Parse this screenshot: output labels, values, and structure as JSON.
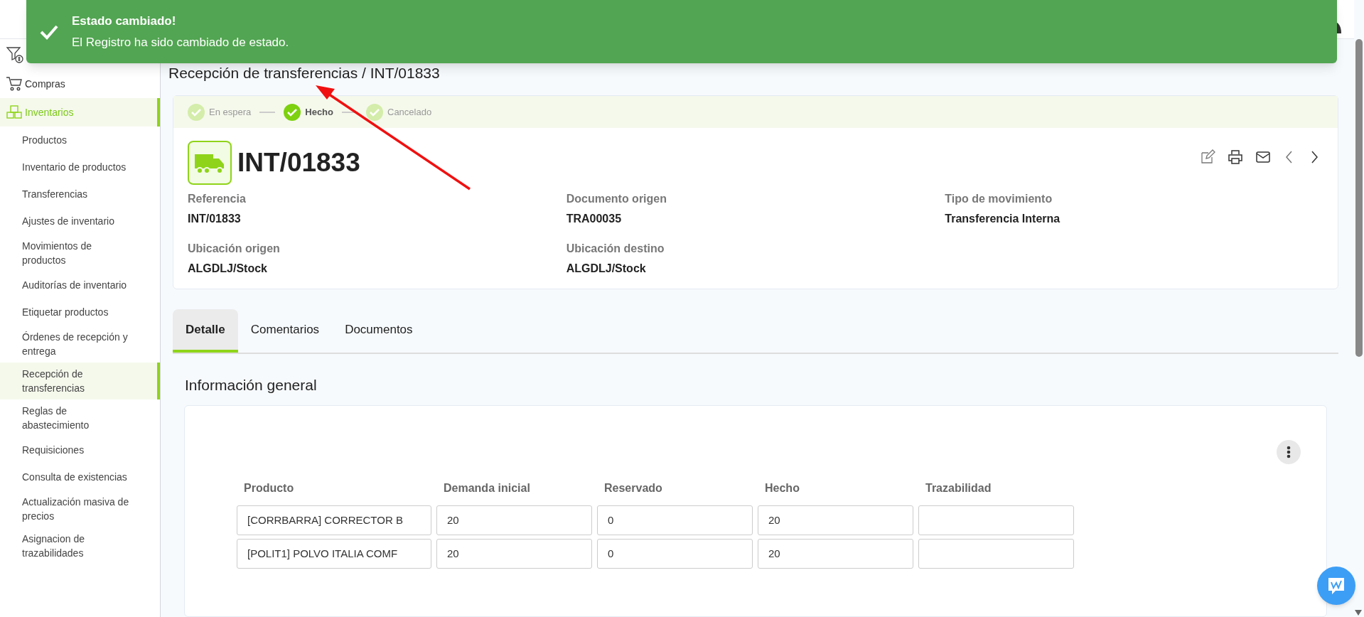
{
  "toast": {
    "title": "Estado cambiado!",
    "message": "El Registro ha sido cambiado de estado."
  },
  "sidebar": {
    "modules": [
      {
        "label": "Compras",
        "selected": false
      },
      {
        "label": "Inventarios",
        "selected": true
      }
    ],
    "items": [
      {
        "label": "Productos",
        "selected": false
      },
      {
        "label": "Inventario de productos",
        "selected": false
      },
      {
        "label": "Transferencias",
        "selected": false
      },
      {
        "label": "Ajustes de inventario",
        "selected": false
      },
      {
        "label": "Movimientos de productos",
        "selected": false
      },
      {
        "label": "Auditorías de inventario",
        "selected": false
      },
      {
        "label": "Etiquetar productos",
        "selected": false
      },
      {
        "label": "Órdenes de recepción y entrega",
        "selected": false
      },
      {
        "label": "Recepción de transferencias",
        "selected": true
      },
      {
        "label": "Reglas de abastecimiento",
        "selected": false
      },
      {
        "label": "Requisiciones",
        "selected": false
      },
      {
        "label": "Consulta de existencias",
        "selected": false
      },
      {
        "label": "Actualización masiva de precios",
        "selected": false
      },
      {
        "label": "Asignacion de trazabilidades",
        "selected": false
      }
    ]
  },
  "page_title": "Recepción de transferencias / INT/01833",
  "status_steps": [
    {
      "label": "En espera",
      "selected": false
    },
    {
      "label": "Hecho",
      "selected": true
    },
    {
      "label": "Cancelado",
      "selected": false
    }
  ],
  "record": {
    "title": "INT/01833",
    "fields": [
      {
        "label": "Referencia",
        "value": "INT/01833"
      },
      {
        "label": "Documento origen",
        "value": "TRA00035"
      },
      {
        "label": "Tipo de movimiento",
        "value": "Transferencia Interna"
      },
      {
        "label": "Ubicación origen",
        "value": "ALGDLJ/Stock"
      },
      {
        "label": "Ubicación destino",
        "value": "ALGDLJ/Stock"
      }
    ]
  },
  "tabs": [
    {
      "label": "Detalle",
      "selected": true
    },
    {
      "label": "Comentarios",
      "selected": false
    },
    {
      "label": "Documentos",
      "selected": false
    }
  ],
  "section_title": "Información general",
  "table": {
    "columns": [
      "Producto",
      "Demanda inicial",
      "Reservado",
      "Hecho",
      "Trazabilidad"
    ],
    "rows": [
      [
        "[CORRBARRA] CORRECTOR B",
        "20",
        "0",
        "20",
        null
      ],
      [
        "[POLIT1] POLVO ITALIA COMF",
        "20",
        "0",
        "20",
        null
      ]
    ]
  }
}
